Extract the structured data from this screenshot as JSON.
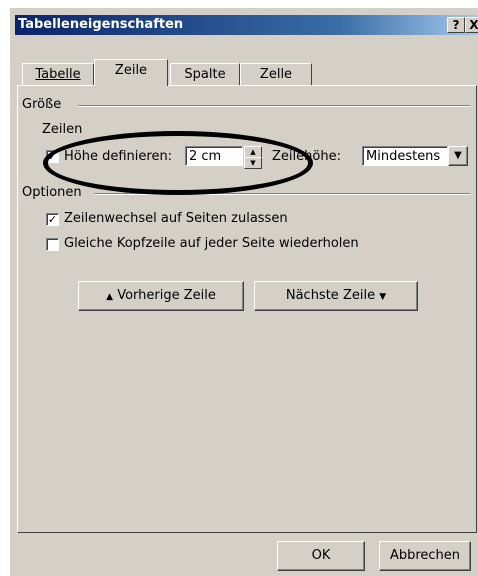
{
  "window": {
    "title": "Tabelleneigenschaften",
    "help_label": "?",
    "close_label": "X"
  },
  "tabs": [
    {
      "label": "Tabelle",
      "active": false
    },
    {
      "label": "Zeile",
      "active": true
    },
    {
      "label": "Spalte",
      "active": false
    },
    {
      "label": "Zelle",
      "active": false
    }
  ],
  "size_group": {
    "title": "Größe",
    "rows_label": "Zeilen",
    "height_checkbox_label": "Höhe definieren:",
    "height_checked": true,
    "height_value": "2 cm",
    "row_height_label_prefix": "Zeile",
    "row_height_label_suffix": "höhe:",
    "row_height_mode": "Mindestens"
  },
  "options_group": {
    "title": "Optionen",
    "allow_break_label": "Zeilenwechsel auf Seiten zulassen",
    "allow_break_checked": true,
    "repeat_header_label": "Gleiche Kopfzeile auf jeder Seite wiederholen",
    "repeat_header_checked": false
  },
  "nav": {
    "prev_label": "Vorherige Zeile",
    "next_label": "Nächste Zeile"
  },
  "footer": {
    "ok_label": "OK",
    "cancel_label": "Abbrechen"
  },
  "colors": {
    "dialog_bg": "#d4d0c8",
    "titlebar_start": "#0a246a",
    "titlebar_end": "#a6caf0",
    "annotation": "#000000"
  }
}
